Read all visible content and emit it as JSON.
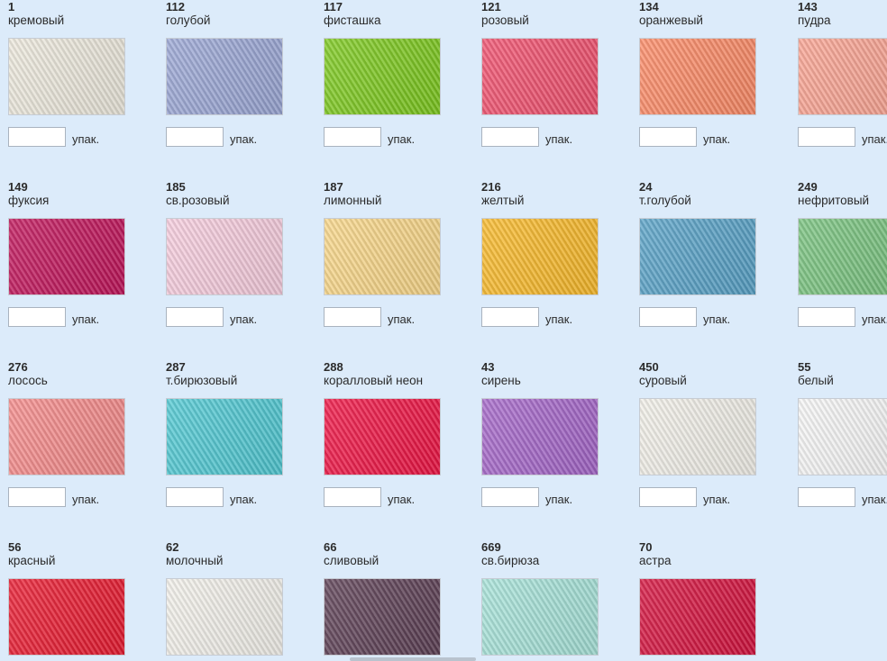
{
  "unit_label": "упак.",
  "colors": [
    {
      "code": "1",
      "name": "кремовый",
      "hex": "#ece8dc"
    },
    {
      "code": "112",
      "name": "голубой",
      "hex": "#9aa6d4"
    },
    {
      "code": "117",
      "name": "фисташка",
      "hex": "#7cc81e"
    },
    {
      "code": "121",
      "name": "розовый",
      "hex": "#f0506e"
    },
    {
      "code": "134",
      "name": "оранжевый",
      "hex": "#fb8a66"
    },
    {
      "code": "143",
      "name": "пудра",
      "hex": "#f9a392"
    },
    {
      "code": "149",
      "name": "фуксия",
      "hex": "#c0145a"
    },
    {
      "code": "185",
      "name": "св.розовый",
      "hex": "#f6ccdd"
    },
    {
      "code": "187",
      "name": "лимонный",
      "hex": "#f8d688"
    },
    {
      "code": "216",
      "name": "желтый",
      "hex": "#f8b92a"
    },
    {
      "code": "24",
      "name": "т.голубой",
      "hex": "#58a1c6"
    },
    {
      "code": "249",
      "name": "нефритовый",
      "hex": "#78c27e"
    },
    {
      "code": "276",
      "name": "лосось",
      "hex": "#f48a8a"
    },
    {
      "code": "287",
      "name": "т.бирюзовый",
      "hex": "#50c8d2"
    },
    {
      "code": "288",
      "name": "коралловый неон",
      "hex": "#ee1444"
    },
    {
      "code": "43",
      "name": "сирень",
      "hex": "#a466c8"
    },
    {
      "code": "450",
      "name": "суровый",
      "hex": "#f1efe8"
    },
    {
      "code": "55",
      "name": "белый",
      "hex": "#f6f6f6"
    },
    {
      "code": "56",
      "name": "красный",
      "hex": "#e81a30"
    },
    {
      "code": "62",
      "name": "молочный",
      "hex": "#f2f0ea"
    },
    {
      "code": "66",
      "name": "сливовый",
      "hex": "#5c3f54"
    },
    {
      "code": "669",
      "name": "св.бирюза",
      "hex": "#a6e2d8"
    },
    {
      "code": "70",
      "name": "астра",
      "hex": "#d4123e"
    }
  ]
}
